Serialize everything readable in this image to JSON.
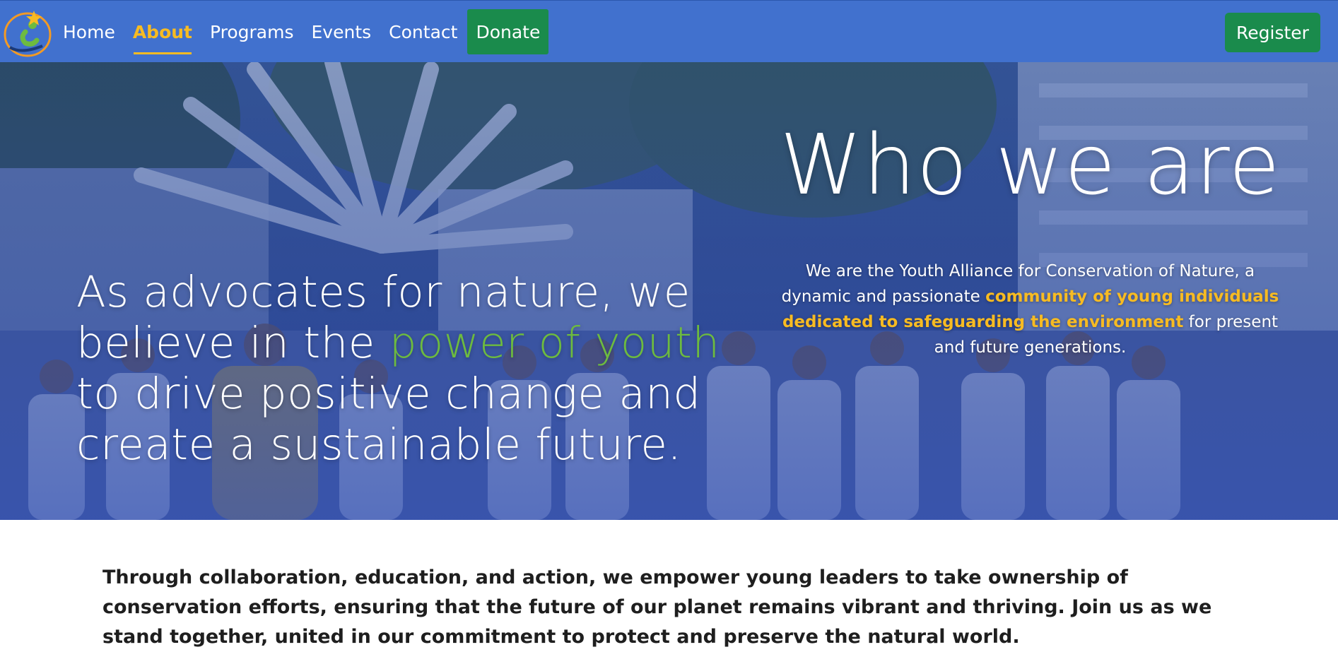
{
  "nav": {
    "items": [
      {
        "label": "Home",
        "active": false
      },
      {
        "label": "About",
        "active": true
      },
      {
        "label": "Programs",
        "active": false
      },
      {
        "label": "Events",
        "active": false
      },
      {
        "label": "Contact",
        "active": false
      }
    ],
    "donate_label": "Donate",
    "register_label": "Register"
  },
  "hero": {
    "tagline_part1": "As advocates for nature, we believe in the ",
    "tagline_highlight": "power of youth",
    "tagline_part2": " to drive positive change and create a sustainable future.",
    "title": "Who we are",
    "desc_part1": "We are the Youth Alliance for Conservation of Nature, a dynamic and passionate ",
    "desc_highlight": "community of young individuals dedicated to safeguarding the environment",
    "desc_part2": " for present and future generations."
  },
  "intro": {
    "text": "Through collaboration, education, and action, we empower young leaders to take ownership of conservation efforts, ensuring that the future of our planet remains vibrant and thriving. Join us as we stand together, united in our commitment to protect and preserve the natural world."
  },
  "colors": {
    "nav_bg": "#4171ce",
    "accent_yellow": "#f7bb22",
    "accent_green": "#6dbb3f",
    "button_green": "#1a8b4c"
  },
  "icons": {
    "logo": "youth-alliance-logo-icon"
  }
}
